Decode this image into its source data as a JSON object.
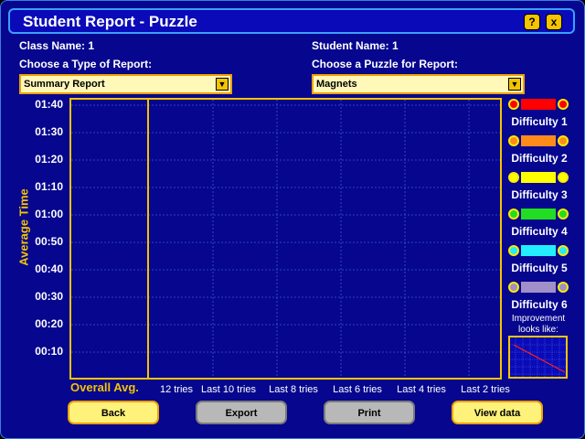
{
  "window": {
    "title": "Student Report - Puzzle",
    "help_icon": "?",
    "close_icon": "x"
  },
  "form": {
    "class_name": "Class Name: 1",
    "student_name": "Student Name: 1",
    "report_type_label": "Choose a Type of Report:",
    "puzzle_label": "Choose a Puzzle for Report:",
    "report_type_value": "Summary Report",
    "puzzle_value": "Magnets"
  },
  "chart_data": {
    "type": "line",
    "ylabel": "Average Time",
    "y_ticks": [
      "01:40",
      "01:30",
      "01:20",
      "01:10",
      "01:00",
      "00:50",
      "00:40",
      "00:30",
      "00:20",
      "00:10"
    ],
    "categories": [
      "Overall Avg.",
      "12 tries",
      "Last 10 tries",
      "Last 8 tries",
      "Last 6 tries",
      "Last 4 tries",
      "Last 2 tries"
    ],
    "series": [],
    "grid": true
  },
  "legend": {
    "items": [
      {
        "label": "Difficulty 1",
        "color": "#ff0000",
        "dot": "#ff0000"
      },
      {
        "label": "Difficulty 2",
        "color": "#ff8c1a",
        "dot": "#ff8c1a"
      },
      {
        "label": "Difficulty 3",
        "color": "#ffff00",
        "dot": "#ffff00"
      },
      {
        "label": "Difficulty 4",
        "color": "#22dd22",
        "dot": "#22dd22"
      },
      {
        "label": "Difficulty 5",
        "color": "#22eeff",
        "dot": "#22eeff"
      },
      {
        "label": "Difficulty 6",
        "color": "#a08fc8",
        "dot": "#a08fc8"
      }
    ],
    "improvement_text": "Improvement looks like:"
  },
  "buttons": {
    "back": "Back",
    "export": "Export",
    "print": "Print",
    "view_data": "View data"
  }
}
